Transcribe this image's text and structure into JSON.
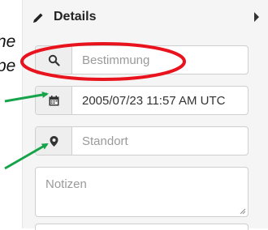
{
  "background_text": {
    "line1": "ne",
    "line2": "pe"
  },
  "panel": {
    "title": "Details",
    "title_icon": "pencil-icon",
    "toggle_icon": "caret-right-icon"
  },
  "fields": {
    "search": {
      "icon": "search-icon",
      "placeholder": "Bestimmung"
    },
    "date": {
      "icon": "calendar-icon",
      "value": "2005/07/23 11:57 AM UTC"
    },
    "location": {
      "icon": "map-marker-icon",
      "placeholder": "Standort"
    },
    "notes": {
      "placeholder": "Notizen"
    }
  },
  "annotations": {
    "highlight_color": "#e8131c",
    "arrow_color": "#16a34a"
  }
}
